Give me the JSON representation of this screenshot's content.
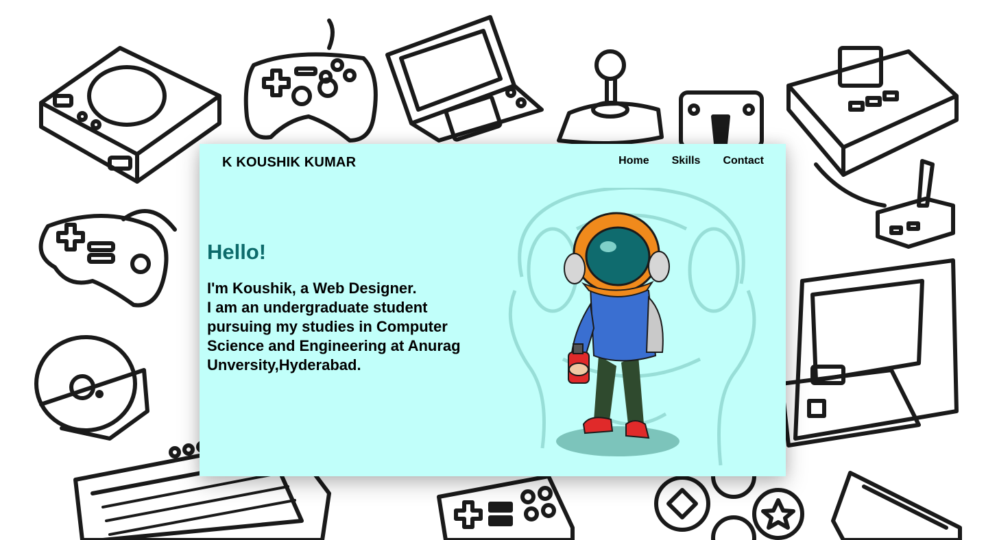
{
  "header": {
    "brand": "K KOUSHIK KUMAR",
    "nav": {
      "home": "Home",
      "skills": "Skills",
      "contact": "Contact"
    }
  },
  "hero": {
    "greeting": "Hello!",
    "line1": "I'm Koushik, a Web Designer.",
    "line2": "I am an undergraduate student pursuing my studies in Computer Science and Engineering at Anurag Unversity,Hyderabad."
  },
  "images": {
    "background": "doodle-game-consoles-pattern",
    "illustration": "astronaut-helmet-character-with-spray-can"
  },
  "colors": {
    "card_background": "#c1fffa",
    "greeting": "#0d6b6b",
    "text": "#000000"
  }
}
